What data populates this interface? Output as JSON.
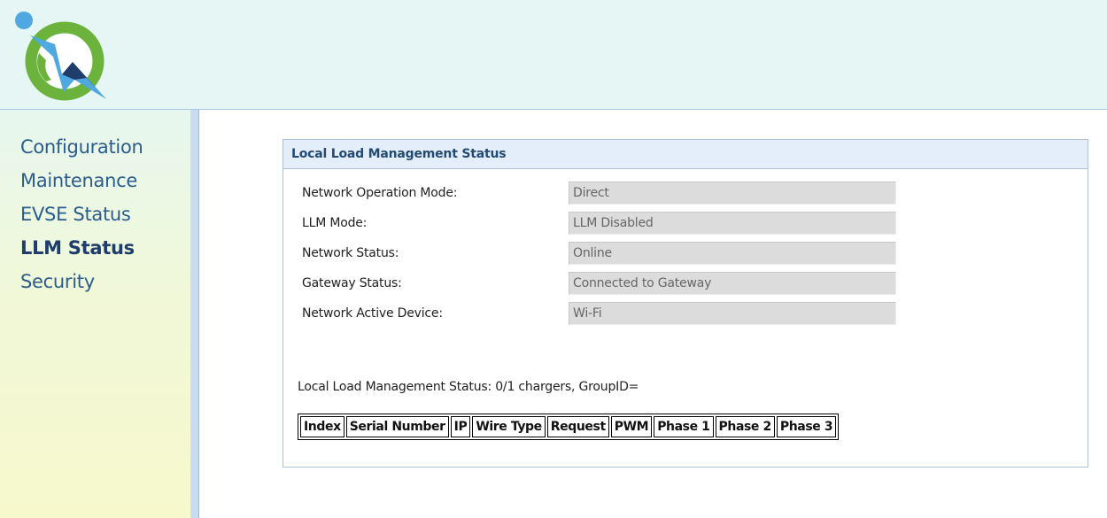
{
  "nav": {
    "items": [
      {
        "label": "Configuration"
      },
      {
        "label": "Maintenance"
      },
      {
        "label": "EVSE Status"
      },
      {
        "label": "LLM Status"
      },
      {
        "label": "Security"
      }
    ],
    "active_index": 3
  },
  "panel": {
    "title": "Local Load Management Status",
    "fields": [
      {
        "label": "Network Operation Mode:",
        "value": "Direct"
      },
      {
        "label": "LLM Mode:",
        "value": "LLM Disabled"
      },
      {
        "label": "Network Status:",
        "value": "Online"
      },
      {
        "label": "Gateway Status:",
        "value": "Connected to Gateway"
      },
      {
        "label": "Network Active Device:",
        "value": "Wi-Fi"
      }
    ],
    "summary": "Local Load Management Status: 0/1 chargers, GroupID=",
    "table": {
      "columns": [
        "Index",
        "Serial Number",
        "IP",
        "Wire Type",
        "Request",
        "PWM",
        "Phase 1",
        "Phase 2",
        "Phase 3"
      ]
    }
  },
  "icons": {
    "logo": "charging-brand-logo-icon"
  },
  "colors": {
    "header_bg": "#e5f6f4",
    "nav_text": "#2a5d8c",
    "nav_active": "#1f3d6b",
    "panel_header_bg": "#e3eefa",
    "logo_green": "#6cb33e",
    "logo_blue": "#4fa8e0"
  }
}
